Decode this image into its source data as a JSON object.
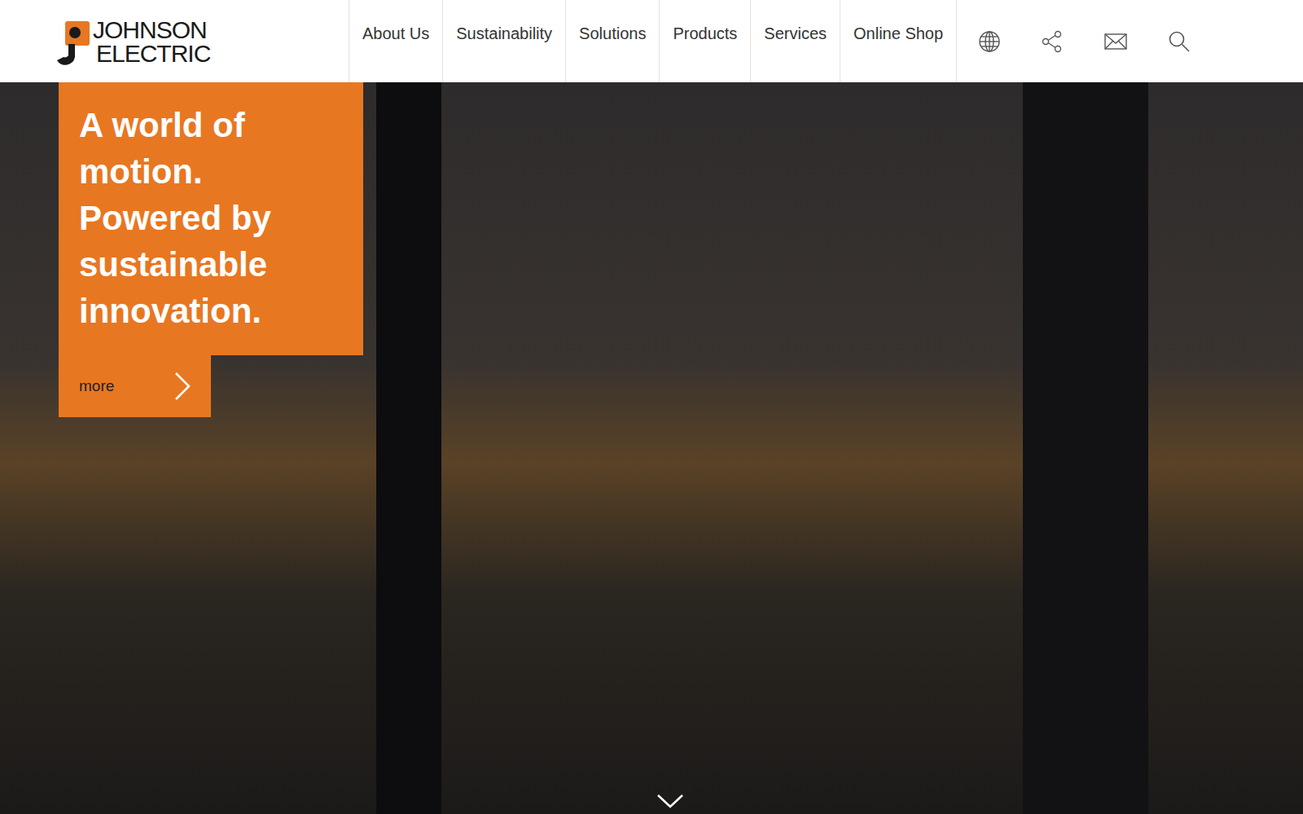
{
  "logo": {
    "lines": [
      "JOHNSON",
      "ELECTRIC"
    ]
  },
  "nav": {
    "items": [
      "About Us",
      "Sustainability",
      "Solutions",
      "Products",
      "Services",
      "Online Shop"
    ]
  },
  "hero": {
    "headline_lines": [
      "A world of",
      "motion.",
      "Powered by",
      "sustainable",
      "innovation."
    ],
    "more": "more"
  }
}
